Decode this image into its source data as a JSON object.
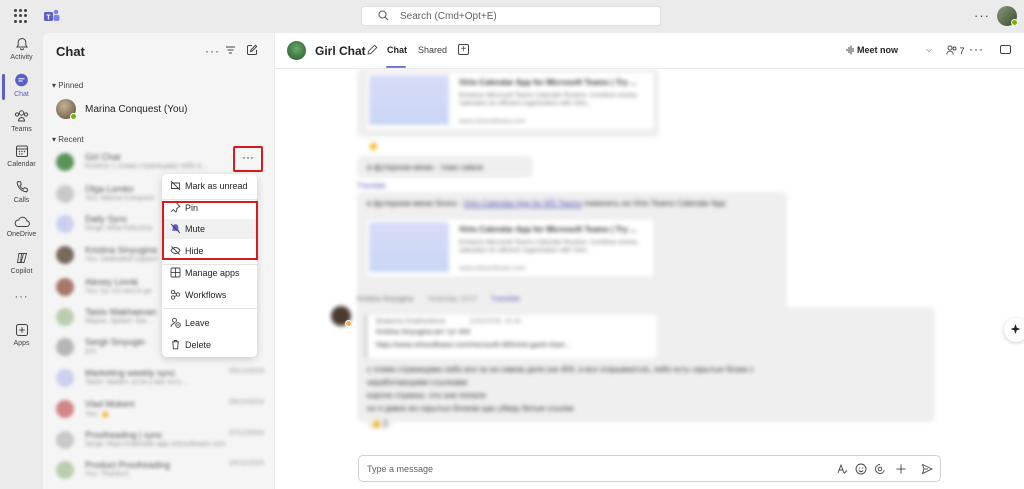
{
  "titlebar": {
    "search_placeholder": "Search (Cmd+Opt+E)",
    "more": "···"
  },
  "rail": {
    "items": [
      {
        "label": "Activity"
      },
      {
        "label": "Chat"
      },
      {
        "label": "Teams"
      },
      {
        "label": "Calendar"
      },
      {
        "label": "Calls"
      },
      {
        "label": "OneDrive"
      },
      {
        "label": "Copilot"
      },
      {
        "label": "···"
      },
      {
        "label": "Apps"
      }
    ]
  },
  "chatlist": {
    "title": "Chat",
    "pinned_label": "Pinned",
    "pinned": [
      {
        "name": "Marina Conquest (You)"
      }
    ],
    "recent_label": "Recent",
    "recent": [
      {
        "name": "Girl Chat",
        "preview": "Kristina: с этими страницами либо в...",
        "date": ""
      },
      {
        "name": "Olga Lomko",
        "preview": "You: Marina Conquest",
        "date": ""
      },
      {
        "name": "Daily Sync",
        "preview": "Sergii: Alisa Kekuzina",
        "date": ""
      },
      {
        "name": "Kristina Sinyugina",
        "preview": "You: Dedicated support",
        "date": ""
      },
      {
        "name": "Alexey Linnik",
        "preview": "You: try что-нести до",
        "date": ""
      },
      {
        "name": "Taisiv Makhaevan",
        "preview": "Марин, привет. Как ...",
        "date": ""
      },
      {
        "name": "Sergii Sinyugin",
        "preview": "you",
        "date": ""
      },
      {
        "name": "Marketing weekly sync",
        "preview": "Taisiv: привет, если у вас есть ...",
        "date": "05/12/2024"
      },
      {
        "name": "Vlad Mokeni",
        "preview": "You: 👍",
        "date": "09/12/2024"
      },
      {
        "name": "Proofreading | sync",
        "preview": "Sergii: https://calendar-app.virtosoftware.com",
        "date": "27/12/2024"
      },
      {
        "name": "Product Proofreading",
        "preview": "You: Thanks!!!",
        "date": "20/11/2024"
      }
    ],
    "more_button": "···"
  },
  "context_menu": {
    "items": [
      {
        "label": "Mark as unread",
        "icon": "mark-unread-icon"
      },
      {
        "label": "Pin",
        "icon": "pin-icon"
      },
      {
        "label": "Mute",
        "icon": "mute-icon"
      },
      {
        "label": "Hide",
        "icon": "hide-icon"
      },
      {
        "label": "Manage apps",
        "icon": "apps-icon"
      },
      {
        "label": "Workflows",
        "icon": "workflows-icon"
      },
      {
        "label": "Leave",
        "icon": "leave-icon"
      },
      {
        "label": "Delete",
        "icon": "delete-icon"
      }
    ]
  },
  "header": {
    "title": "Girl Chat",
    "tabs": [
      {
        "label": "Chat"
      },
      {
        "label": "Shared"
      }
    ],
    "meet_now": "Meet now",
    "participants": "7",
    "more": "···"
  },
  "messages": {
    "card1": {
      "title": "Virto Calendar App for Microsoft Teams | Try ...",
      "desc": "Enhance Microsoft Teams Calendar Routine. Combine events, calendars for efficient organization with Virto...",
      "url": "www.virtosoftware.com"
    },
    "emoji1": "👍",
    "line1": "в футерном меню - тоже самое",
    "translate1": "Translate",
    "line2_prefix": "в футерном меню блога - ",
    "line2_link": "Virto Calendar App for MS Teams",
    "line2_suffix": " поменять на  Virto Teams Calendar App",
    "card2": {
      "title": "Virto Calendar App for Microsoft Teams | Try ...",
      "desc": "Enhance Microsoft Teams Calendar Routine. Combine events, calendars for efficient organization with Virto...",
      "url": "www.virtosoftware.com"
    },
    "sender": "Kristina Sinyugina",
    "sender_time": "Yesterday 15:07",
    "translate2": "Translate",
    "quote_author": "Ekaterina Chakhonkova",
    "quote_date": "11/02/2025, 15:34",
    "quote_line1": "Kristina Sinyugina вот тут 404",
    "quote_line2": "https://www.virtosoftware.com/microsoft-365/virto-gantt-chart-...",
    "body1": "с этими страницами либо все ок на самом деле (не 404, а все открывается), либо есть скрытые блоки с",
    "body2": "неработающими ссылками",
    "body3": "короче страннo, что они попали",
    "body4": "но я давно во скрытых блоков щас уберу битые ссылки",
    "reaction": "👍 2"
  },
  "composer": {
    "placeholder": "Type a message"
  },
  "colors": {
    "accent": "#5b5fc7",
    "highlight_border": "#d71920",
    "presence": "#6bb700"
  }
}
